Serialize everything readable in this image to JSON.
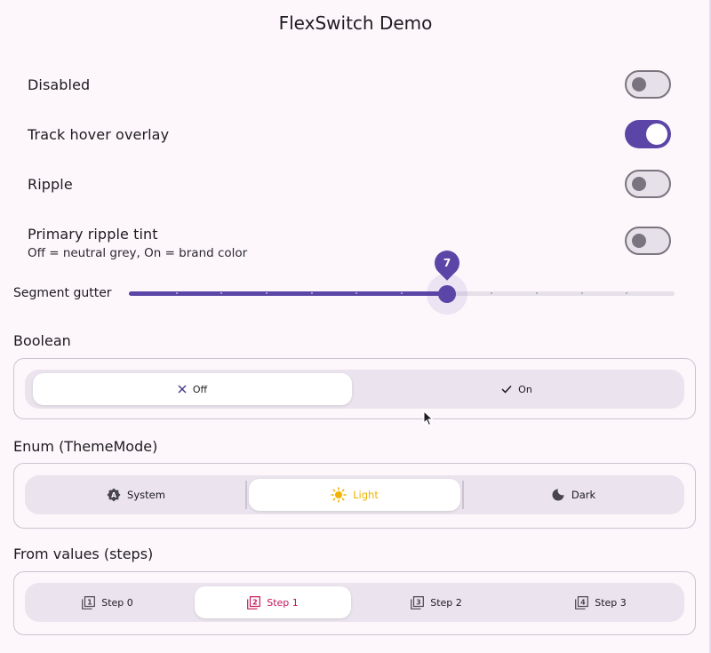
{
  "app": {
    "title": "FlexSwitch Demo"
  },
  "settings": [
    {
      "label": "Disabled",
      "on": false
    },
    {
      "label": "Track hover overlay",
      "on": true
    },
    {
      "label": "Ripple",
      "on": false
    },
    {
      "label": "Primary ripple tint",
      "subtitle": "Off = neutral grey, On = brand color",
      "on": false
    }
  ],
  "slider": {
    "label": "Segment gutter",
    "value": 7,
    "value_text": "7",
    "min": 0,
    "max": 12,
    "divisions": 12
  },
  "sections": {
    "boolean": {
      "title": "Boolean",
      "options": [
        {
          "label": "Off",
          "icon": "close-icon",
          "selected": true
        },
        {
          "label": "On",
          "icon": "check-icon",
          "selected": false
        }
      ]
    },
    "enum": {
      "title": "Enum (ThemeMode)",
      "options": [
        {
          "label": "System",
          "icon": "brightness-auto-icon",
          "selected": false
        },
        {
          "label": "Light",
          "icon": "sun-icon",
          "selected": true
        },
        {
          "label": "Dark",
          "icon": "moon-icon",
          "selected": false
        }
      ]
    },
    "steps": {
      "title": "From values (steps)",
      "options": [
        {
          "label": "Step 0",
          "icon": "filter-1-icon",
          "selected": false
        },
        {
          "label": "Step 1",
          "icon": "filter-2-icon",
          "selected": true
        },
        {
          "label": "Step 2",
          "icon": "filter-3-icon",
          "selected": false
        },
        {
          "label": "Step 3",
          "icon": "filter-4-icon",
          "selected": false
        }
      ]
    }
  },
  "colors": {
    "primary": "#5b45a6",
    "track_off": "#e6e0e9",
    "outline": "#79747e",
    "light_accent": "#f0b400",
    "step_accent": "#c2185b",
    "background": "#fdf7fc"
  }
}
